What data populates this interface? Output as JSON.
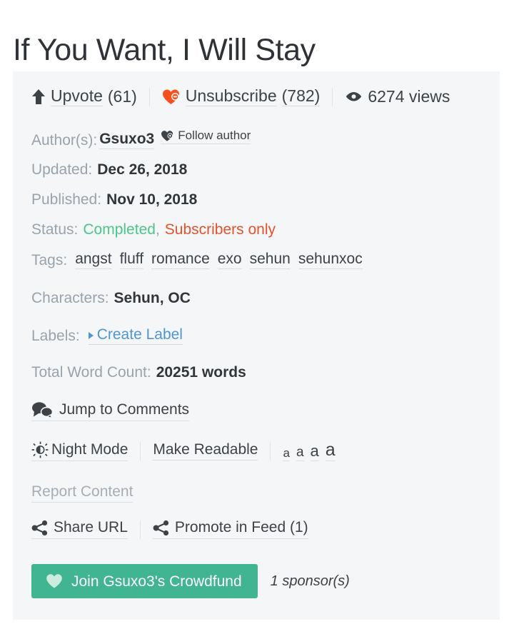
{
  "story": {
    "title": "If You Want, I Will Stay"
  },
  "actions": {
    "upvote": {
      "label": "Upvote",
      "count": "(61)",
      "icon": "up-arrow-icon"
    },
    "subscribe": {
      "label": "Unsubscribe",
      "count": "(782)",
      "icon": "heart-minus-icon"
    },
    "views": {
      "text": "6274 views",
      "icon": "eye-icon"
    }
  },
  "meta": {
    "author_label": "Author(s):",
    "author_name": "Gsuxo3",
    "follow_author": "Follow author",
    "updated_label": "Updated:",
    "updated_value": "Dec 26, 2018",
    "published_label": "Published:",
    "published_value": "Nov 10, 2018",
    "status_label": "Status:",
    "status_completed": "Completed",
    "status_separator": ",",
    "status_access": "Subscribers only",
    "tags_label": "Tags:",
    "tags": [
      "angst",
      "fluff",
      "romance",
      "exo",
      "sehun",
      "sehunxoc"
    ],
    "characters_label": "Characters:",
    "characters_value": "Sehun, OC",
    "labels_label": "Labels:",
    "create_label": "Create Label",
    "wordcount_label": "Total Word Count:",
    "wordcount_value": "20251 words"
  },
  "tools": {
    "jump_to_comments": "Jump to Comments",
    "night_mode": "Night Mode",
    "make_readable": "Make Readable",
    "font_sizes": [
      "a",
      "a",
      "a",
      "a"
    ],
    "report_content": "Report Content",
    "share_url": "Share URL",
    "promote_in_feed": "Promote in Feed (1)"
  },
  "crowdfund": {
    "button_label": "Join Gsuxo3's Crowdfund",
    "sponsors": "1 sponsor(s)"
  },
  "colors": {
    "panel_bg": "#f4f6f8",
    "title": "#2f3337",
    "label_gray": "#9aa3ab",
    "value_dark": "#31363b",
    "status_completed": "#4dc58a",
    "status_subscribers": "#e2532a",
    "link_blue": "#4f96d2",
    "heart_orange": "#f4511e",
    "crowdfund_green": "#41b492"
  }
}
